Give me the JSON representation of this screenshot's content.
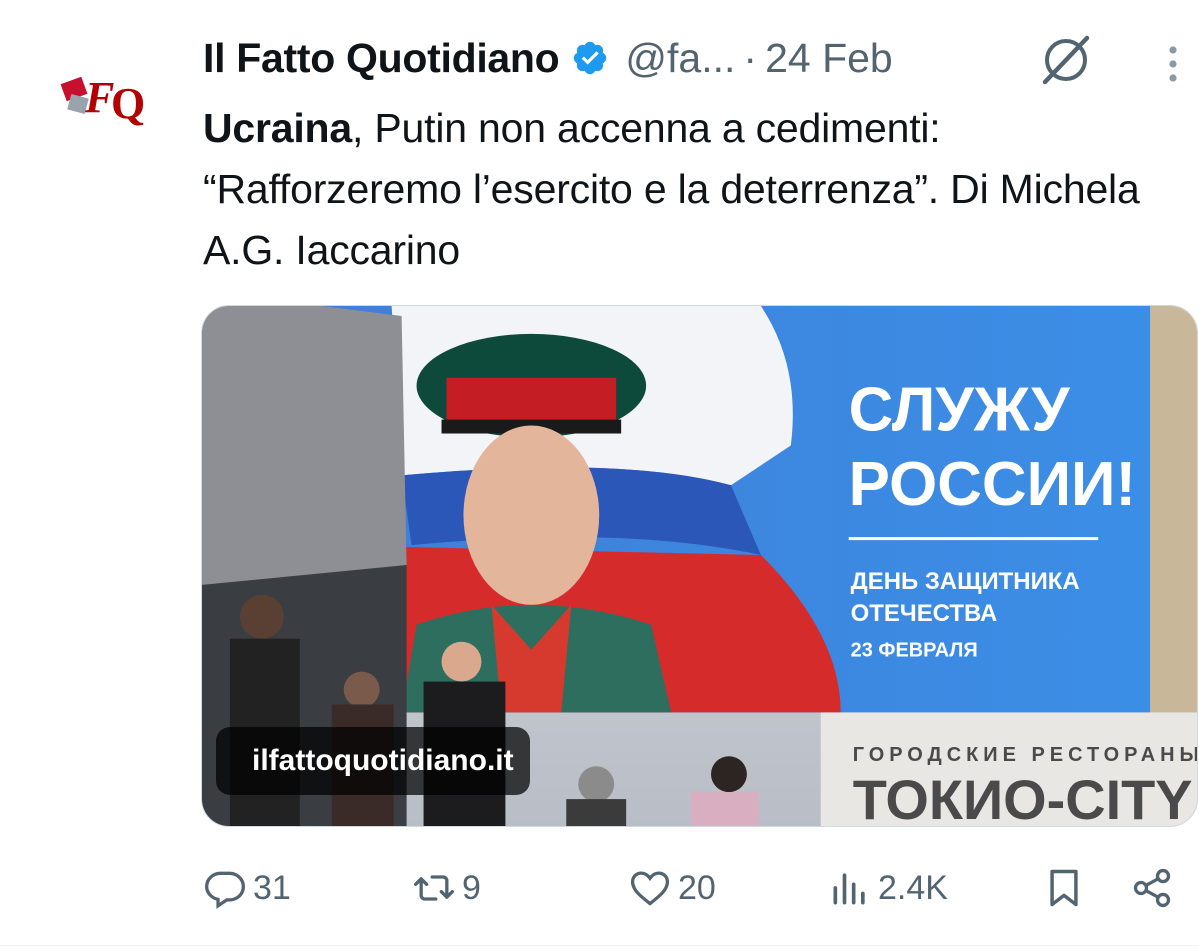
{
  "tweet": {
    "author": {
      "name": "Il Fatto Quotidiano",
      "handle": "@fa...",
      "avatar_alt": "FQ",
      "verified_icon": "verified-badge-icon"
    },
    "separator": "·",
    "date": "24 Feb",
    "text": {
      "bold": "Ucraina",
      "rest": ", Putin non accenna a cedimenti: “Rafforzeremo l’esercito e la deterrenza”. Di Michela A.G. Iaccarino"
    },
    "media": {
      "source_label": "ilfattoquotidiano.it",
      "billboard_lines": [
        "СЛУЖУ",
        "РОССИИ!"
      ],
      "billboard_sub": [
        "ДЕНЬ ЗАЩИТНИКА",
        "ОТЕЧЕСТВА",
        "23 ФЕВРАЛЯ"
      ],
      "storefront_small": "ГОРОДСКИЕ РЕСТОРАНЫ",
      "storefront_big": "ТОКИО-CITY"
    },
    "actions": {
      "replies": "31",
      "reposts": "9",
      "likes": "20",
      "views": "2.4K"
    }
  },
  "colors": {
    "text": "#0f1419",
    "secondary": "#536471",
    "verified": "#1d9bf0"
  }
}
